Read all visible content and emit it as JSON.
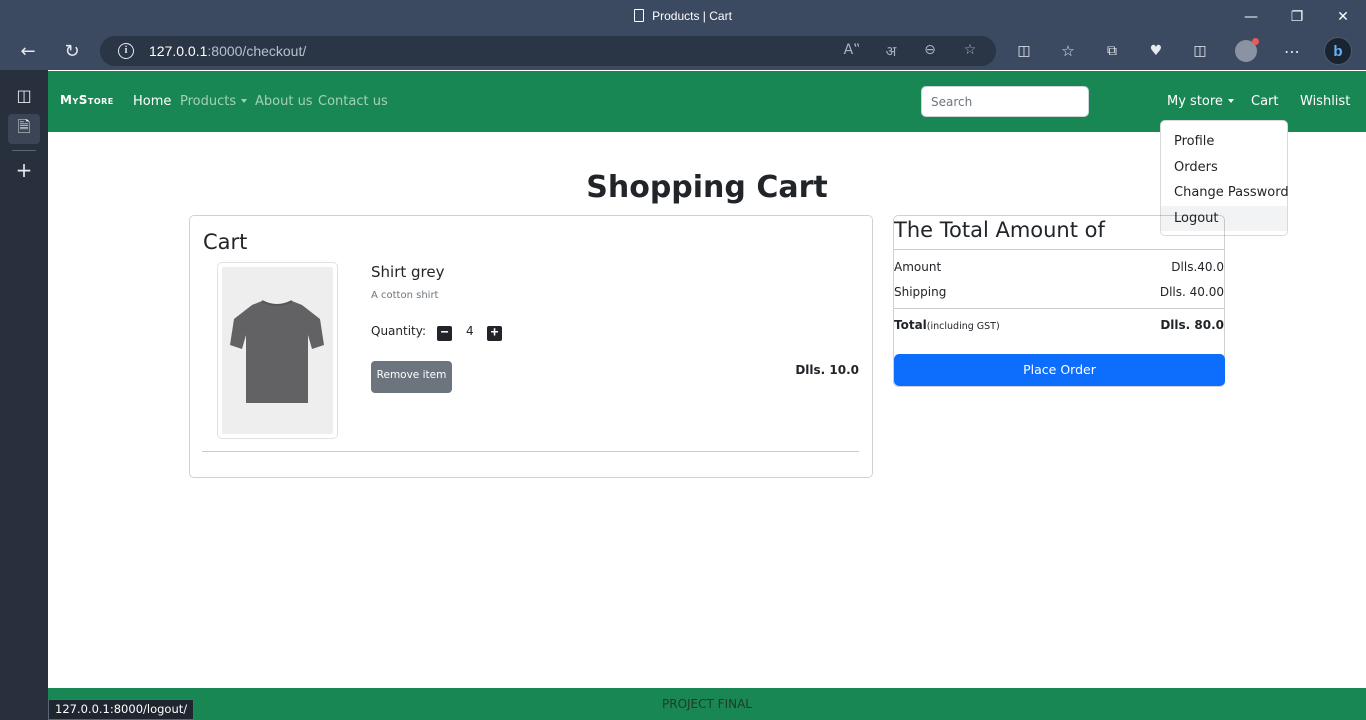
{
  "browser": {
    "tab_title": "Products | Cart",
    "url_host": "127.0.0.1",
    "url_rest": ":8000/checkout/",
    "status_url": "127.0.0.1:8000/logout/"
  },
  "navbar": {
    "brand": "MyStore",
    "links": [
      "Home",
      "Products",
      "About us",
      "Contact us"
    ],
    "search_placeholder": "Search",
    "right_links": [
      "My store",
      "Cart",
      "Wishlist"
    ]
  },
  "dropdown": {
    "items": [
      "Profile",
      "Orders",
      "Change Password",
      "Logout"
    ]
  },
  "main": {
    "title": "Shopping Cart",
    "cart": {
      "header": "Cart",
      "item": {
        "name": "Shirt grey",
        "description": "A cotton shirt",
        "quantity_label": "Quantity:",
        "quantity": "4",
        "remove_label": "Remove item",
        "price": "Dlls. 10.0"
      }
    },
    "summary": {
      "header": "The Total Amount of",
      "amount_label": "Amount",
      "amount_value": "Dlls.40.0",
      "shipping_label": "Shipping",
      "shipping_value": "Dlls. 40.00",
      "total_label": "Total",
      "total_note": "(including GST)",
      "total_value": "Dlls. 80.0",
      "place_order_label": "Place Order"
    }
  },
  "footer": {
    "text": "PROJECT FINAL"
  },
  "colors": {
    "navbar": "#198754",
    "primary": "#0d6efd",
    "secondary": "#6c757d",
    "browser_chrome": "#3b4a60"
  }
}
